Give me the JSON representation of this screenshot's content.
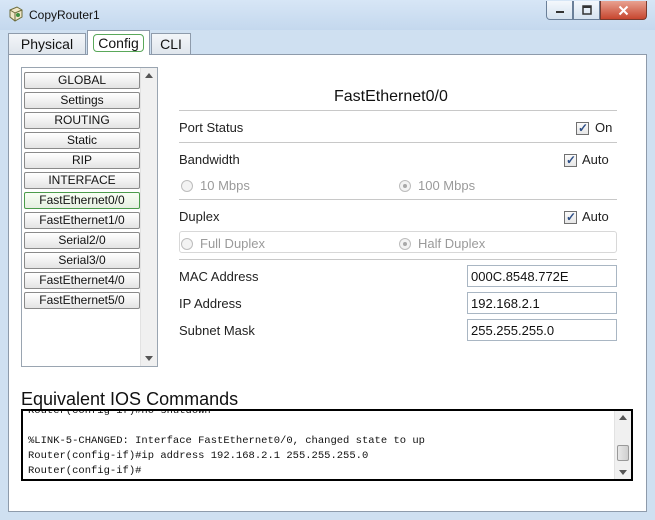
{
  "window": {
    "title": "CopyRouter1"
  },
  "tabs": [
    {
      "label": "Physical"
    },
    {
      "label": "Config"
    },
    {
      "label": "CLI"
    }
  ],
  "nav": {
    "items": [
      {
        "label": "GLOBAL"
      },
      {
        "label": "Settings"
      },
      {
        "label": "ROUTING"
      },
      {
        "label": "Static"
      },
      {
        "label": "RIP"
      },
      {
        "label": "INTERFACE"
      },
      {
        "label": "FastEthernet0/0"
      },
      {
        "label": "FastEthernet1/0"
      },
      {
        "label": "Serial2/0"
      },
      {
        "label": "Serial3/0"
      },
      {
        "label": "FastEthernet4/0"
      },
      {
        "label": "FastEthernet5/0"
      }
    ],
    "selected": "FastEthernet0/0"
  },
  "interface": {
    "title": "FastEthernet0/0",
    "port_status": {
      "label": "Port Status",
      "checkbox_label": "On",
      "checked": true
    },
    "bandwidth": {
      "label": "Bandwidth",
      "checkbox_label": "Auto",
      "checked": true,
      "options": [
        "10 Mbps",
        "100 Mbps"
      ],
      "selected": "100 Mbps"
    },
    "duplex": {
      "label": "Duplex",
      "checkbox_label": "Auto",
      "checked": true,
      "options": [
        "Full Duplex",
        "Half Duplex"
      ],
      "selected": "Half Duplex"
    },
    "mac": {
      "label": "MAC Address",
      "value": "000C.8548.772E"
    },
    "ip": {
      "label": "IP Address",
      "value": "192.168.2.1"
    },
    "subnet": {
      "label": "Subnet Mask",
      "value": "255.255.255.0"
    }
  },
  "ios": {
    "title": "Equivalent IOS Commands",
    "lines": [
      "Router(config-if)#no shutdown",
      "",
      "%LINK-5-CHANGED: Interface FastEthernet0/0, changed state to up",
      "Router(config-if)#ip address 192.168.2.1 255.255.255.0",
      "Router(config-if)#"
    ]
  },
  "colors": {
    "selected_border": "#4b9b4b",
    "close_button": "#c7462f"
  }
}
